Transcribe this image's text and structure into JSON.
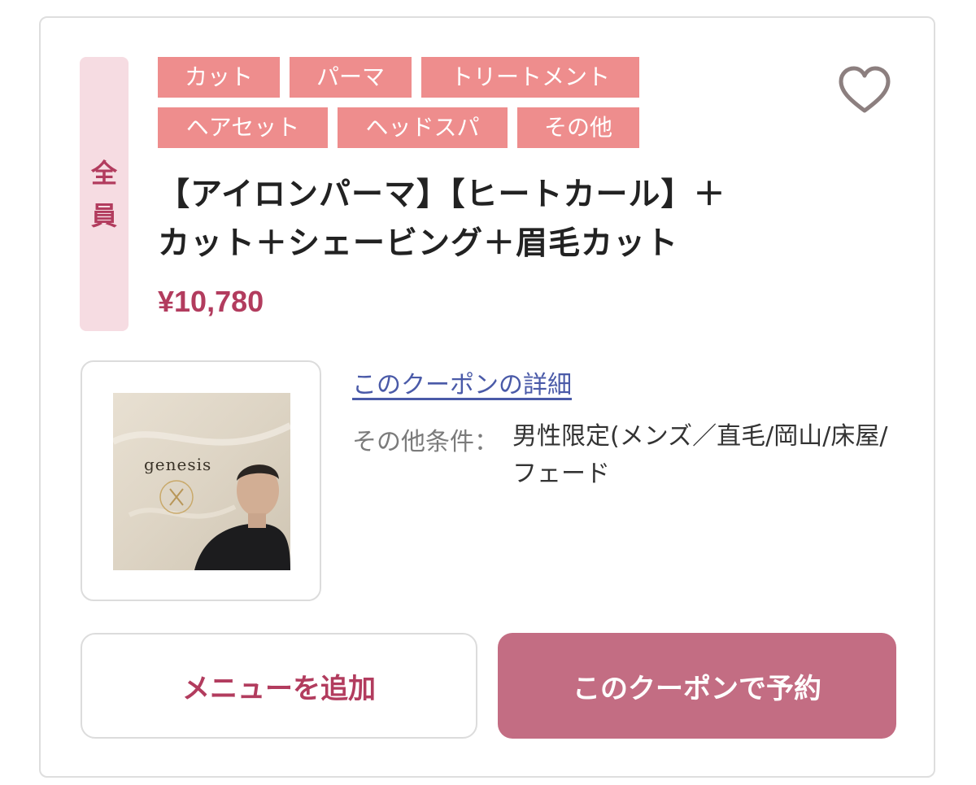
{
  "coupon": {
    "target_badge": [
      "全",
      "員"
    ],
    "tags_row1": [
      "カット",
      "パーマ",
      "トリートメント"
    ],
    "tags_row2": [
      "ヘアセット",
      "ヘッドスパ",
      "その他"
    ],
    "title_line1": "【アイロンパーマ】【ヒートカール】＋",
    "title_line2": "カット＋シェービング＋眉毛カット",
    "price": "¥10,780",
    "detail_link": "このクーポンの詳細",
    "condition_label": "その他条件：",
    "condition_value": "男性限定(メンズ／直毛/岡山/床屋/フェード",
    "thumbnail_text": "genesis",
    "favorite_icon": "heart-outline-icon"
  },
  "actions": {
    "add_menu_label": "メニューを追加",
    "reserve_label": "このクーポンで予約"
  },
  "colors": {
    "accent": "#b23c5e",
    "tag_bg": "#ee8d8d",
    "badge_bg": "#f6dce2",
    "reserve_bg": "#c36d83",
    "link": "#4a5aa8"
  }
}
